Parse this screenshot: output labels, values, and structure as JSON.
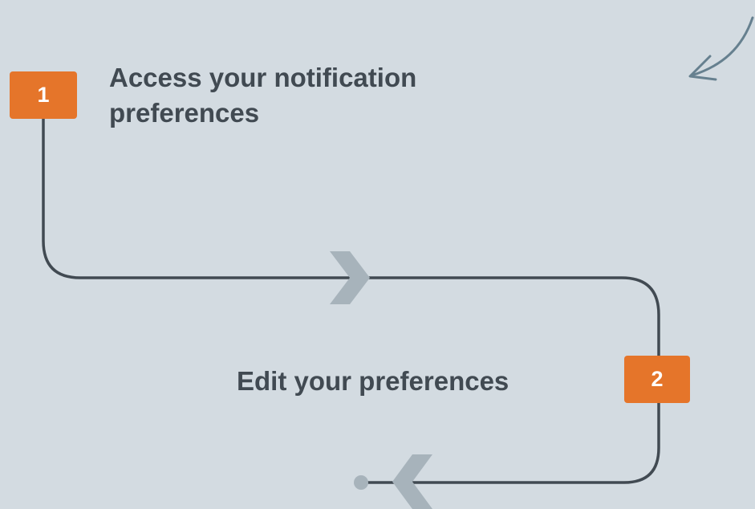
{
  "steps": [
    {
      "number": "1",
      "title": "Access your notification preferences"
    },
    {
      "number": "2",
      "title": "Edit your preferences"
    }
  ],
  "colors": {
    "background": "#d3dbe1",
    "badge": "#e5752a",
    "badge_text": "#ffffff",
    "title_text": "#414a52",
    "connector": "#414a52",
    "chevron": "#a7b3bb",
    "doodle_arrow": "#66808f"
  }
}
